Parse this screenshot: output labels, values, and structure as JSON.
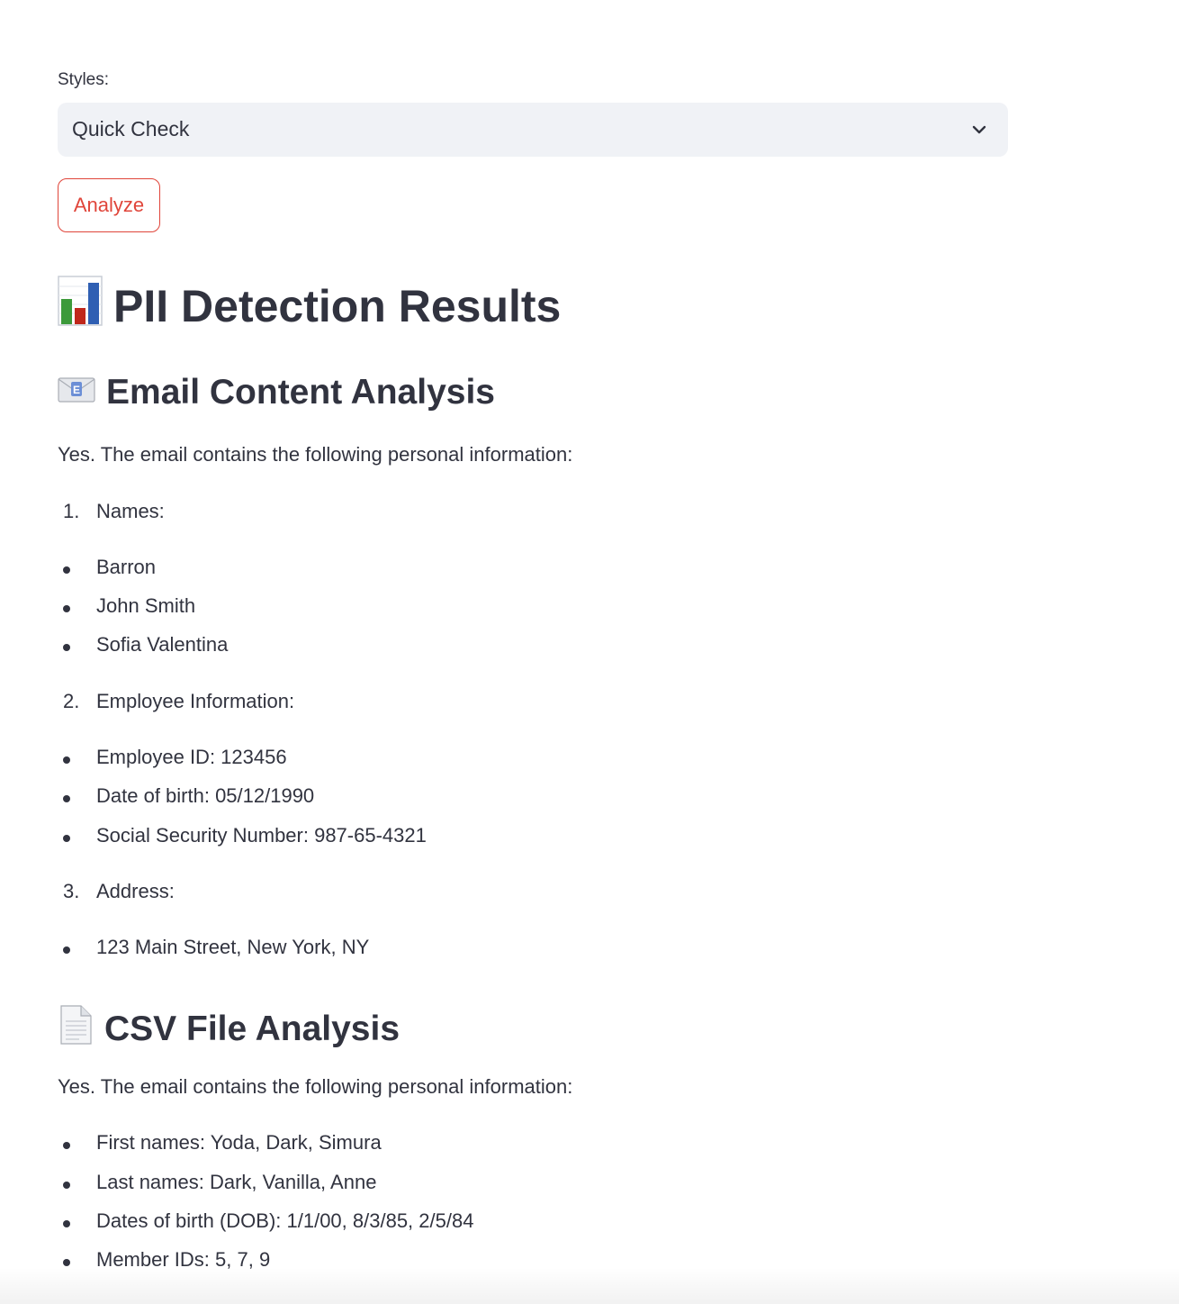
{
  "styles": {
    "label": "Styles:",
    "selected": "Quick Check"
  },
  "analyze_button": "Analyze",
  "results_title": "PII Detection Results",
  "email_section": {
    "title": "Email Content Analysis",
    "intro": "Yes. The email contains the following personal information:",
    "groups": [
      {
        "number": "1.",
        "label": "Names:",
        "items": [
          "Barron",
          "John Smith",
          "Sofia Valentina"
        ]
      },
      {
        "number": "2.",
        "label": "Employee Information:",
        "items": [
          "Employee ID: 123456",
          "Date of birth: 05/12/1990",
          "Social Security Number: 987-65-4321"
        ]
      },
      {
        "number": "3.",
        "label": "Address:",
        "items": [
          "123 Main Street, New York, NY"
        ]
      }
    ]
  },
  "csv_section": {
    "title": "CSV File Analysis",
    "intro": "Yes. The email contains the following personal information:",
    "items": [
      "First names: Yoda, Dark, Simura",
      "Last names: Dark, Vanilla, Anne",
      "Dates of birth (DOB): 1/1/00, 8/3/85, 2/5/84",
      "Member IDs: 5, 7, 9"
    ]
  },
  "icons": {
    "results": "bar-chart-icon",
    "email": "envelope-icon",
    "csv": "document-icon"
  }
}
